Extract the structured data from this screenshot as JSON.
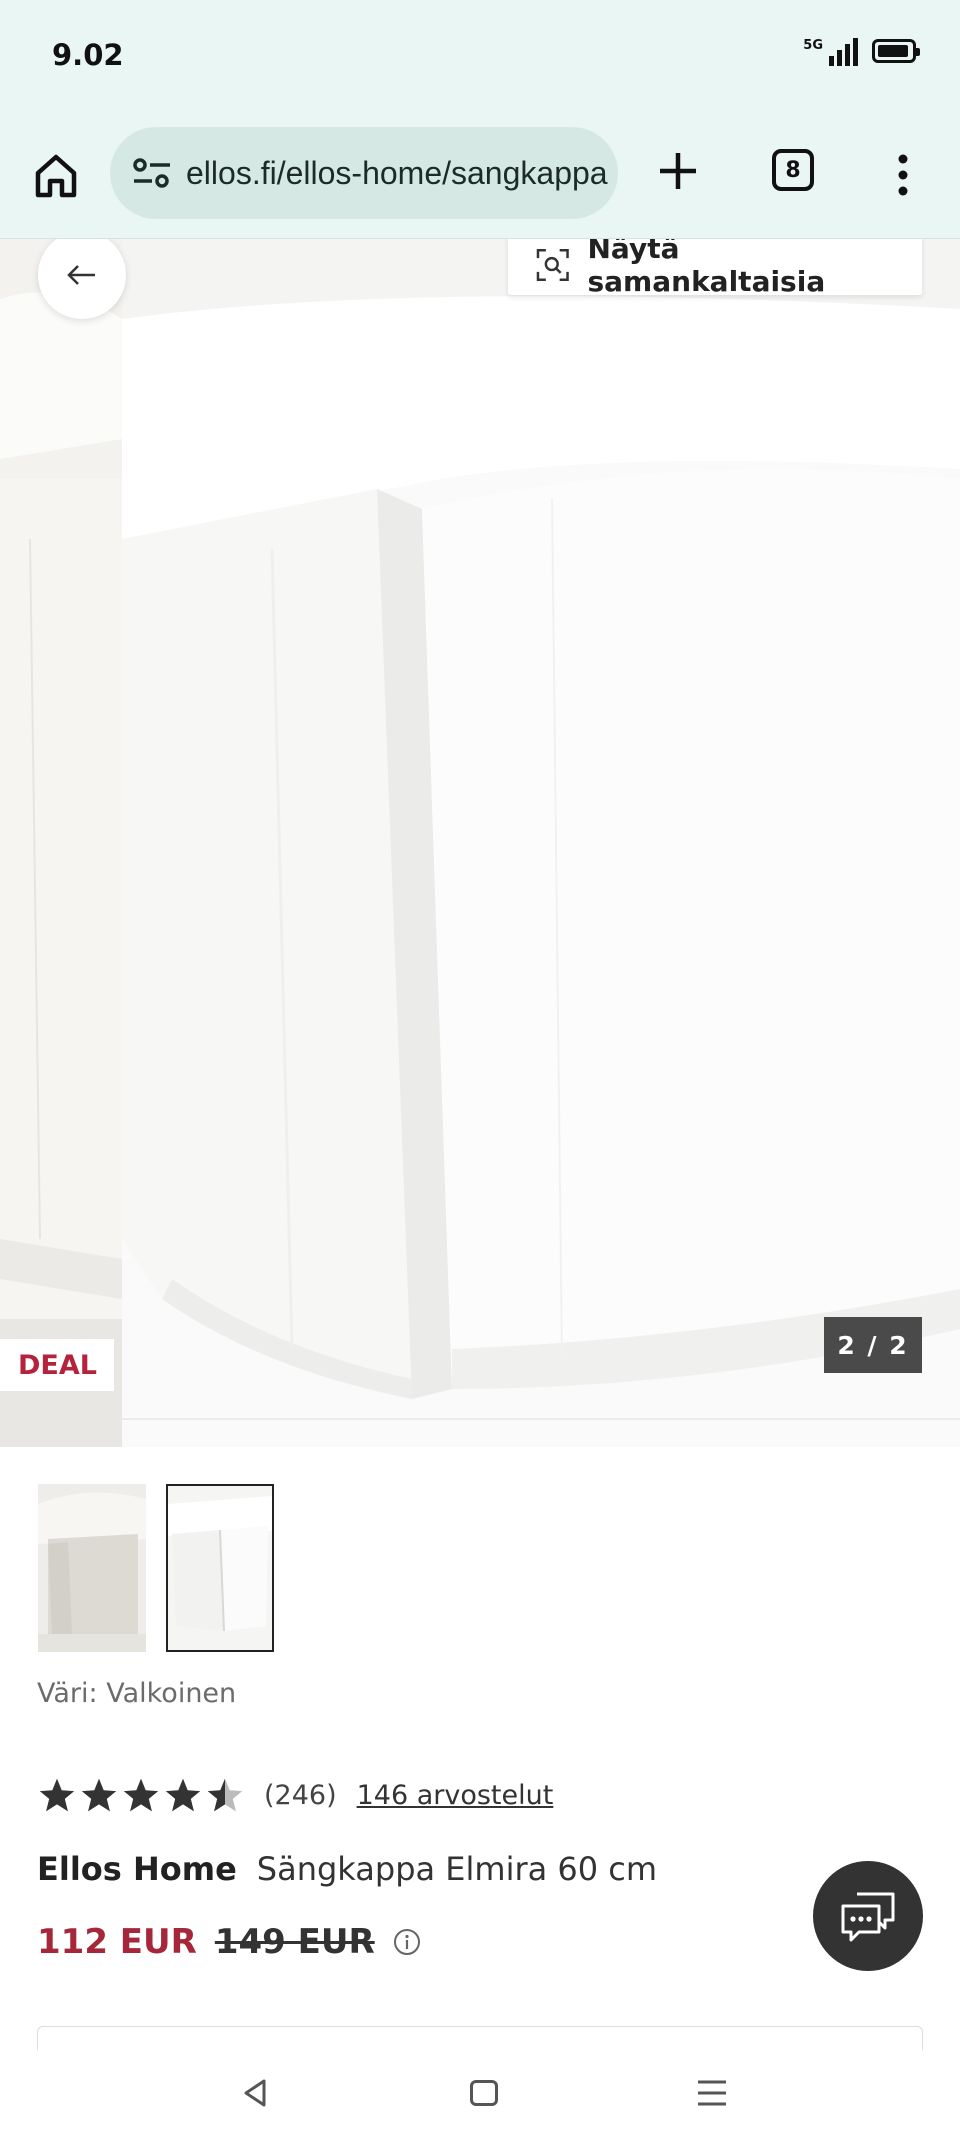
{
  "status_bar": {
    "time": "9.02",
    "network": "5G",
    "signal_level": 4,
    "battery_level": 0.85
  },
  "browser": {
    "url": "ellos.fi/ellos-home/sangkappa",
    "tab_count": "8"
  },
  "gallery": {
    "similar_label": "Näytä samankaltaisia",
    "deal_label": "DEAL",
    "counter": "2 / 2",
    "selected_thumbnail": 2
  },
  "product": {
    "color_label": "Väri: Valkoinen",
    "rating": 4.5,
    "rating_count": "(246)",
    "reviews_link": "146 arvostelut",
    "brand": "Ellos Home",
    "name": "Sängkappa Elmira 60 cm",
    "price": "112 EUR",
    "old_price": "149 EUR"
  },
  "icons": {
    "home": "home-icon",
    "site_settings": "tune-icon",
    "new_tab": "plus-icon",
    "menu": "more-vert-icon",
    "back": "arrow-left-icon",
    "visual_search": "visual-search-icon",
    "info": "info-icon",
    "chat": "chat-icon"
  },
  "colors": {
    "price": "#a6263a",
    "deal": "#b5223b",
    "browser_bar": "#e9f6f3"
  }
}
